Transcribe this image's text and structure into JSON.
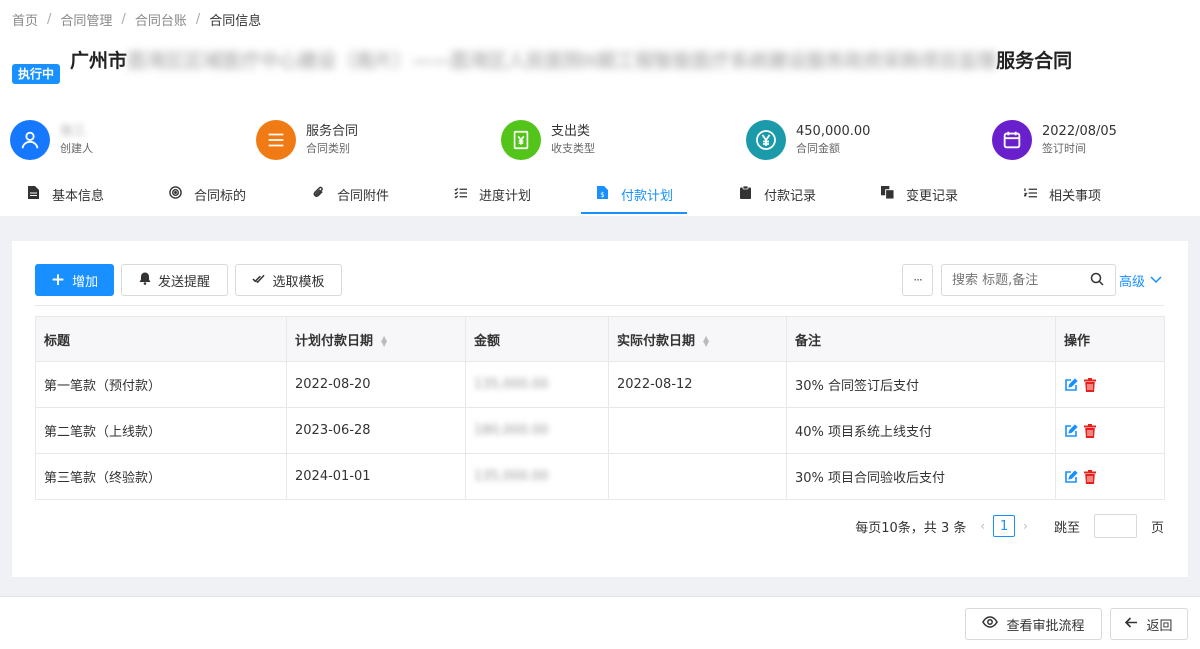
{
  "breadcrumb": {
    "items": [
      "首页",
      "合同管理",
      "合同台账"
    ],
    "current": "合同信息"
  },
  "header": {
    "status": "执行中",
    "title_prefix": "广州市",
    "title_blurred": "荔湾区区域医疗中心建设（南片）——荔湾区人民医院II期工程智能医疗系统建设服务政府采购项目监理",
    "title_suffix": "服务合同"
  },
  "stats": [
    {
      "value": "张三",
      "label": "创建人",
      "icon": "user-icon",
      "color": "#1677ff",
      "blurred": true
    },
    {
      "value": "服务合同",
      "label": "合同类别",
      "icon": "list-icon",
      "color": "#f07a14",
      "blurred": false
    },
    {
      "value": "支出类",
      "label": "收支类型",
      "icon": "yen-bill-icon",
      "color": "#52c41a",
      "blurred": false
    },
    {
      "value": "450,000.00",
      "label": "合同金额",
      "icon": "yen-coin-icon",
      "color": "#1b9aaa",
      "blurred": false
    },
    {
      "value": "2022/08/05",
      "label": "签订时间",
      "icon": "calendar-icon",
      "color": "#6a1fcc",
      "blurred": false
    }
  ],
  "tabs": [
    {
      "label": "基本信息",
      "icon": "file-icon"
    },
    {
      "label": "合同标的",
      "icon": "target-icon"
    },
    {
      "label": "合同附件",
      "icon": "paperclip-icon"
    },
    {
      "label": "进度计划",
      "icon": "checklist-icon"
    },
    {
      "label": "付款计划",
      "icon": "file-dollar-icon",
      "active": true
    },
    {
      "label": "付款记录",
      "icon": "clipboard-icon"
    },
    {
      "label": "变更记录",
      "icon": "copy-icon"
    },
    {
      "label": "相关事项",
      "icon": "ordered-list-icon"
    }
  ],
  "toolbar": {
    "add": "增加",
    "remind": "发送提醒",
    "template": "选取模板",
    "more": "···",
    "search_placeholder": "搜索 标题,备注",
    "advanced": "高级"
  },
  "table": {
    "columns": [
      "标题",
      "计划付款日期",
      "金额",
      "实际付款日期",
      "备注",
      "操作"
    ],
    "rows": [
      {
        "title": "第一笔款（预付款）",
        "plan_date": "2022-08-20",
        "amount": "135,000.00",
        "actual_date": "2022-08-12",
        "note": "30% 合同签订后支付"
      },
      {
        "title": "第二笔款（上线款）",
        "plan_date": "2023-06-28",
        "amount": "180,000.00",
        "actual_date": "",
        "note": "40% 项目系统上线支付"
      },
      {
        "title": "第三笔款（终验款）",
        "plan_date": "2024-01-01",
        "amount": "135,000.00",
        "actual_date": "",
        "note": "30% 项目合同验收后支付"
      }
    ]
  },
  "pagination": {
    "summary": "每页10条，共 3 条",
    "prev": "‹",
    "current_page": "1",
    "next": "›",
    "jump_label": "跳至",
    "page_unit": "页"
  },
  "footer": {
    "approval": "查看审批流程",
    "back": "返回"
  }
}
